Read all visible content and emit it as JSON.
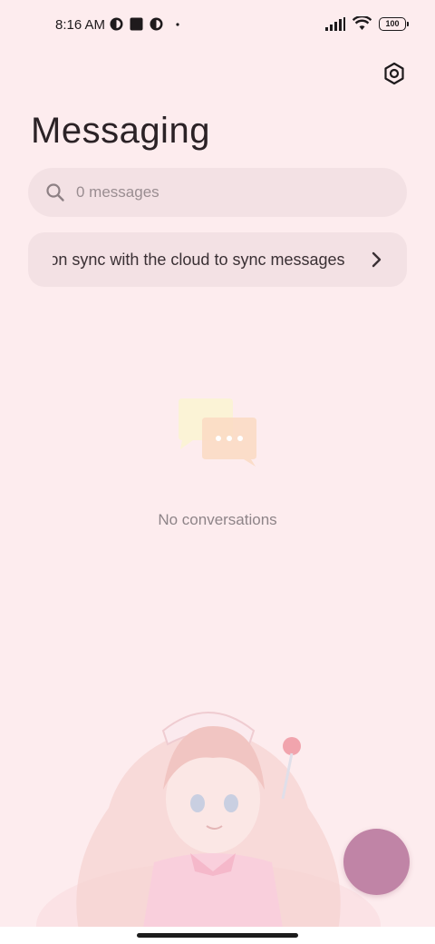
{
  "status_bar": {
    "time": "8:16 AM",
    "battery": "100"
  },
  "header": {
    "title": "Messaging",
    "settings_icon": "settings-gear-icon"
  },
  "search": {
    "placeholder": "0 messages",
    "icon": "search-icon"
  },
  "sync_banner": {
    "text": "Turn on sync with the cloud to sync messages",
    "icon": "chevron-right-icon"
  },
  "empty_state": {
    "icon": "chat-bubbles-icon",
    "text": "No conversations"
  },
  "compose": {
    "icon": "compose-fab"
  },
  "colors": {
    "background": "#fdecee",
    "fab": "#c084a6",
    "field": "#f3e1e4"
  }
}
